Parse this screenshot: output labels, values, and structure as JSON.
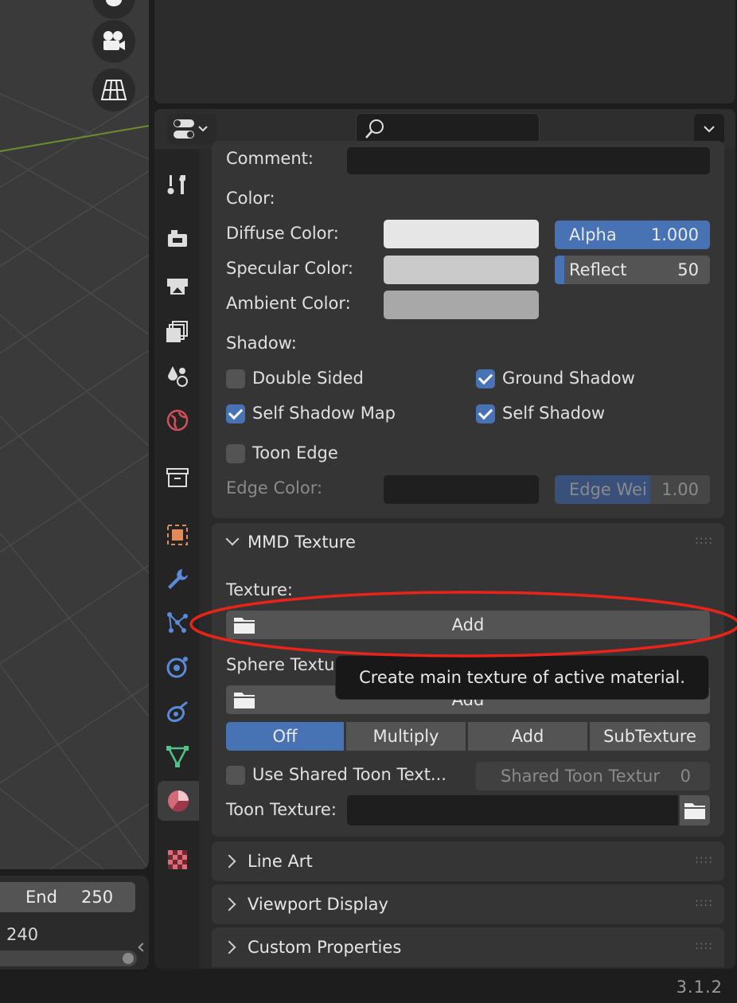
{
  "timeline": {
    "end_label": "End",
    "end_value": "250",
    "current_frame": "240"
  },
  "header": {
    "search_placeholder": ""
  },
  "settings": {
    "comment_label": "Comment:",
    "color_label": "Color:",
    "diffuse_label": "Diffuse Color:",
    "diffuse_color": "#e6e6e6",
    "specular_label": "Specular Color:",
    "specular_color": "#cacaca",
    "ambient_label": "Ambient Color:",
    "ambient_color": "#a8a8a8",
    "alpha_label": "Alpha",
    "alpha_value": "1.000",
    "reflect_label": "Reflect",
    "reflect_value": "50",
    "shadow_label": "Shadow:",
    "double_sided": "Double Sided",
    "ground_shadow": "Ground Shadow",
    "self_shadow_map": "Self Shadow Map",
    "self_shadow": "Self Shadow",
    "toon_edge": "Toon Edge",
    "edge_color_label": "Edge Color:",
    "edge_weight_label": "Edge Wei",
    "edge_weight_value": "1.00"
  },
  "mmd_texture": {
    "title": "MMD Texture",
    "texture_label": "Texture:",
    "add_label": "Add",
    "sphere_label": "Sphere Textu",
    "sphere_add_label": "Add",
    "tooltip": "Create main texture of active material.",
    "modes": [
      "Off",
      "Multiply",
      "Add",
      "SubTexture"
    ],
    "use_shared_label": "Use Shared Toon Text...",
    "shared_toon_label": "Shared Toon Textur",
    "shared_toon_value": "0",
    "toon_texture_label": "Toon Texture:"
  },
  "collapsed_panels": [
    "Line Art",
    "Viewport Display",
    "Custom Properties"
  ],
  "status": {
    "version": "3.1.2"
  },
  "colors": {
    "accent": "#4772b3",
    "highlight": "#e8241a"
  }
}
